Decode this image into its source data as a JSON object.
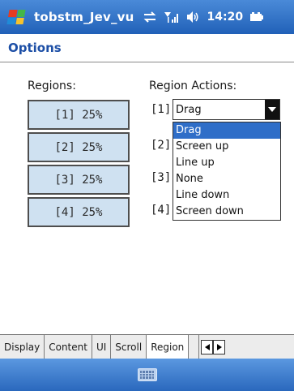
{
  "titlebar": {
    "app_title": "tobstm_Jev_vu",
    "time": "14:20",
    "icons": [
      "windows-start-icon",
      "sync-icon",
      "signal-icon",
      "speaker-icon",
      "battery-icon"
    ]
  },
  "page": {
    "title": "Options"
  },
  "regions": {
    "label": "Regions:",
    "buttons": [
      "[1] 25%",
      "[2] 25%",
      "[3] 25%",
      "[4] 25%"
    ]
  },
  "actions": {
    "label": "Region Actions:",
    "rows": [
      "[1]",
      "[2]",
      "[3]",
      "[4]"
    ],
    "dropdown_value": "Drag",
    "options": [
      "Drag",
      "Screen up",
      "Line up",
      "None",
      "Line down",
      "Screen down"
    ],
    "selected_option": "Drag"
  },
  "tabs": {
    "items": [
      "Display",
      "Content",
      "UI",
      "Scroll",
      "Region"
    ],
    "active": "Region"
  },
  "colors": {
    "titlebar": "#2e6ec4",
    "accent": "#1d4fa6",
    "region_button": "#cfe1f1",
    "selected_option": "#2f6ec8"
  }
}
